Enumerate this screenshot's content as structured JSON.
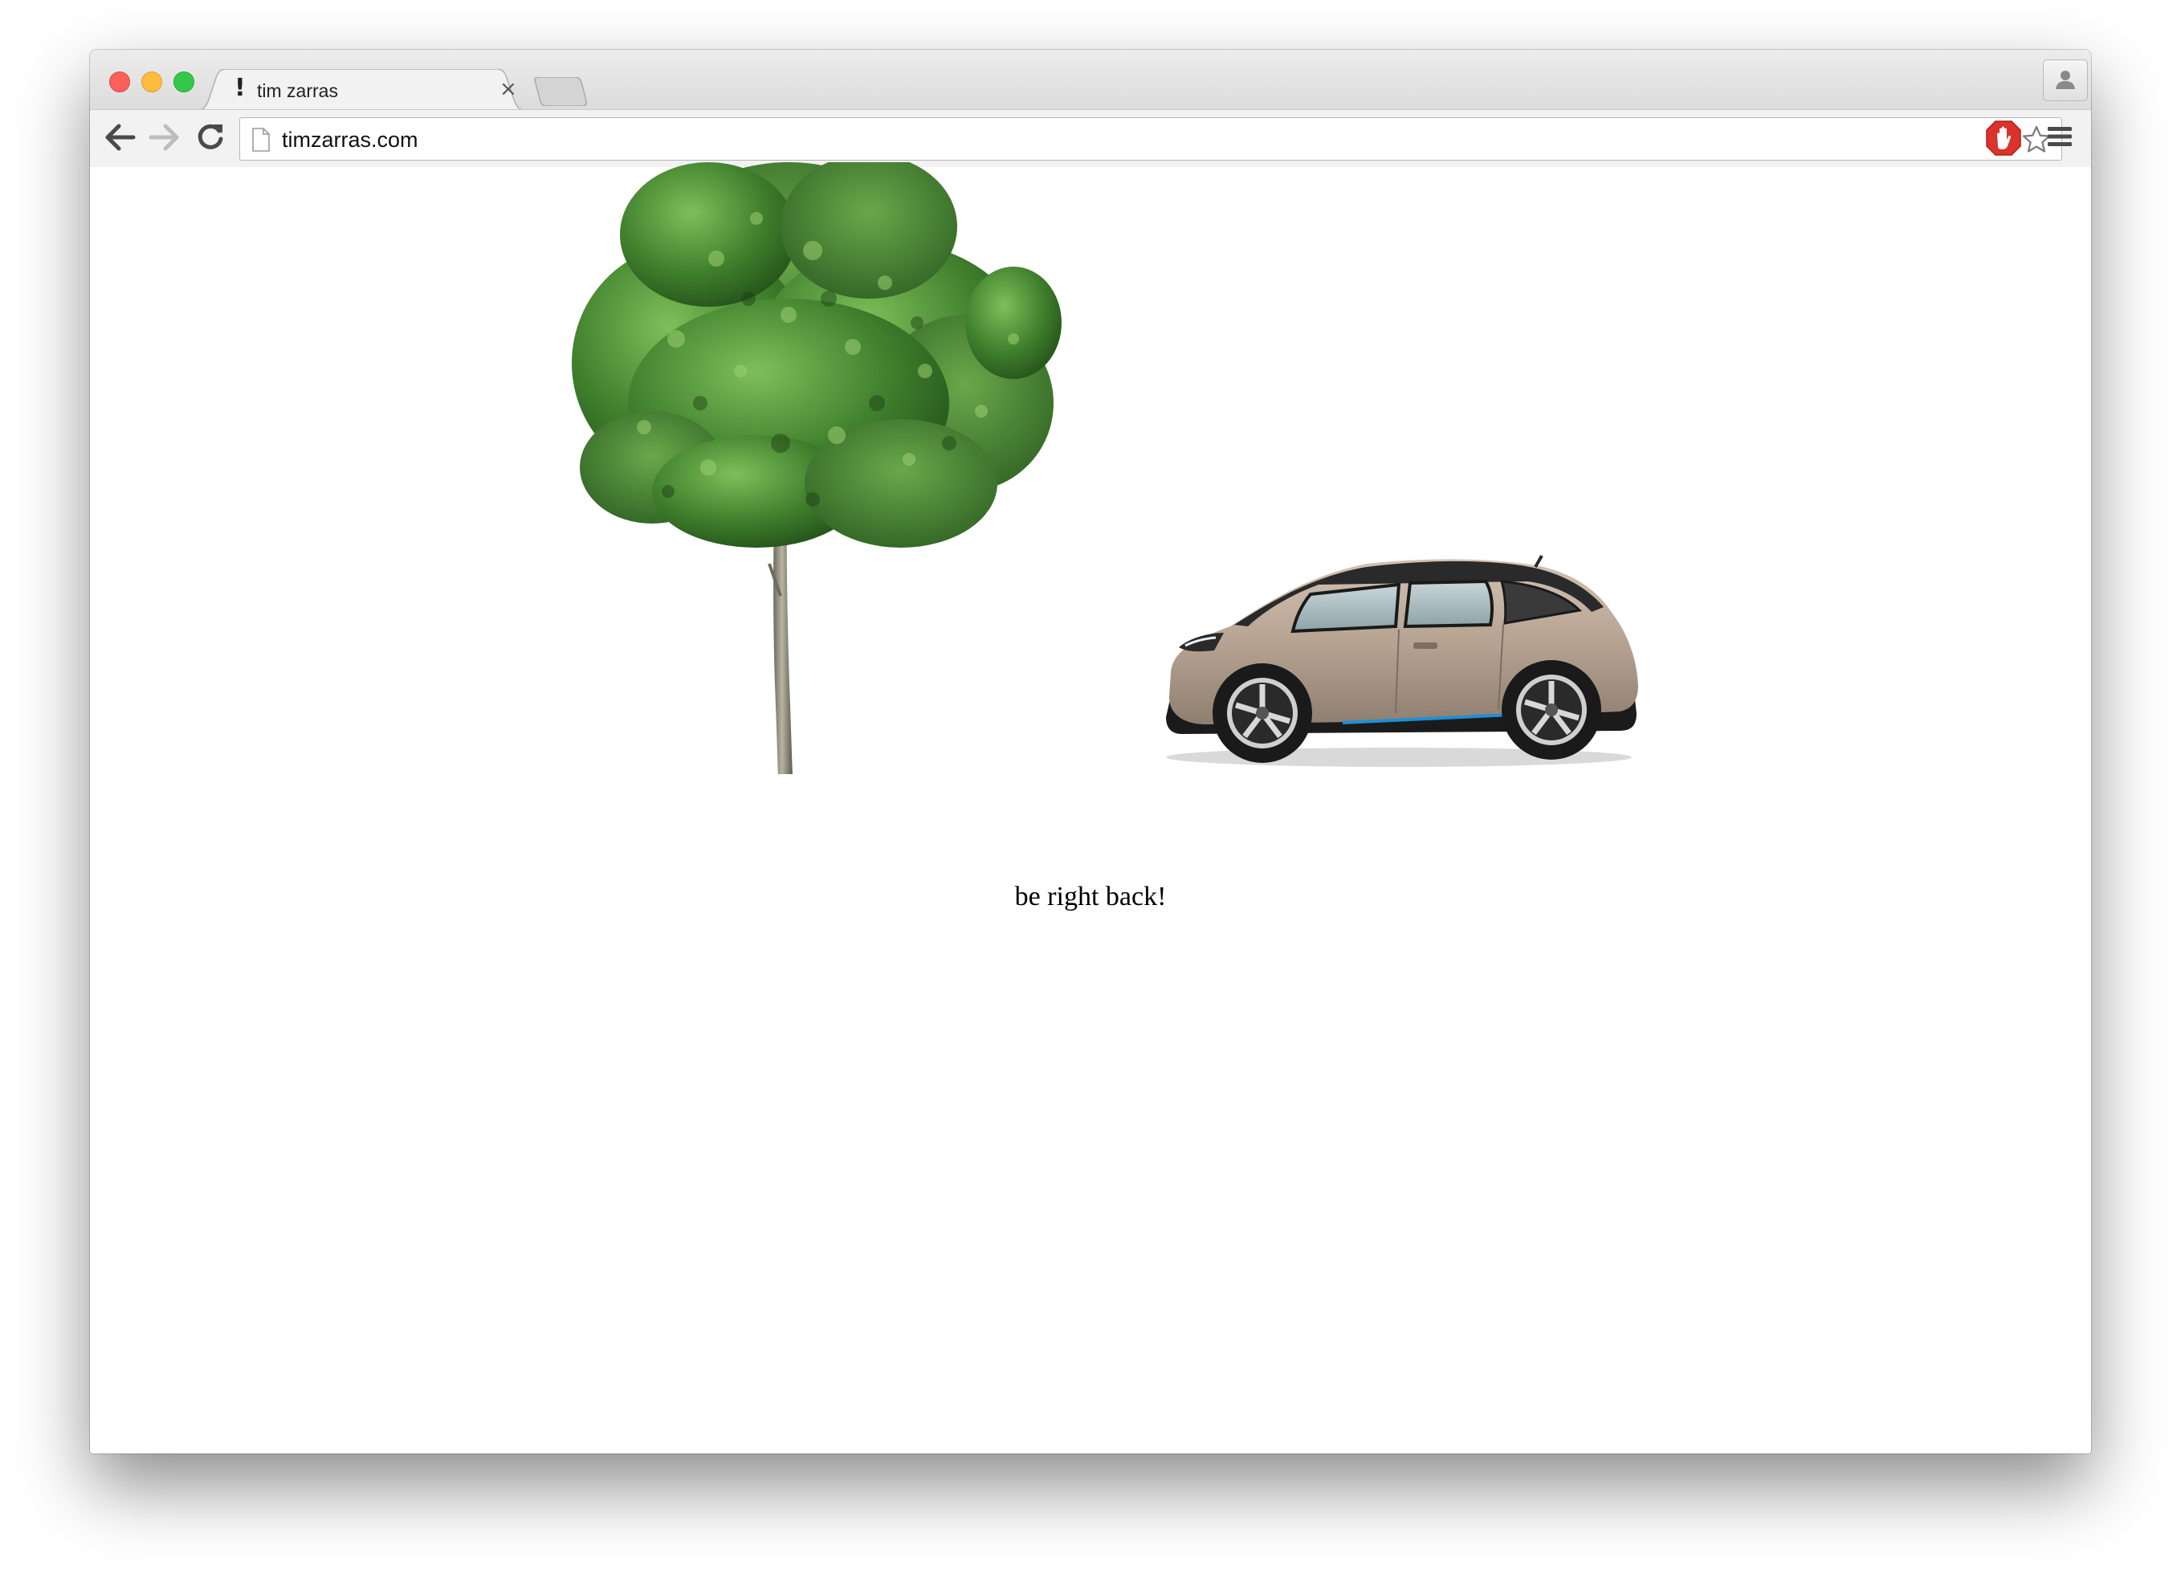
{
  "window": {
    "controls": [
      "close",
      "minimize",
      "zoom"
    ]
  },
  "tabs": [
    {
      "favicon": "!",
      "title": "tim zarras",
      "close_label": "×",
      "active": true
    }
  ],
  "toolbar": {
    "back_icon": "back-arrow-icon",
    "forward_icon": "forward-arrow-icon",
    "reload_icon": "reload-icon",
    "url": "timzarras.com",
    "bookmark_icon": "star-icon",
    "extension_icon": "stop-hand-icon",
    "menu_icon": "hamburger-menu-icon"
  },
  "page": {
    "message": "be right back!",
    "images": [
      "tree",
      "electric-car"
    ]
  },
  "colors": {
    "close": "#fc605b",
    "minimize": "#fdbc40",
    "zoom": "#34c84a",
    "extension": "#d9332b"
  }
}
